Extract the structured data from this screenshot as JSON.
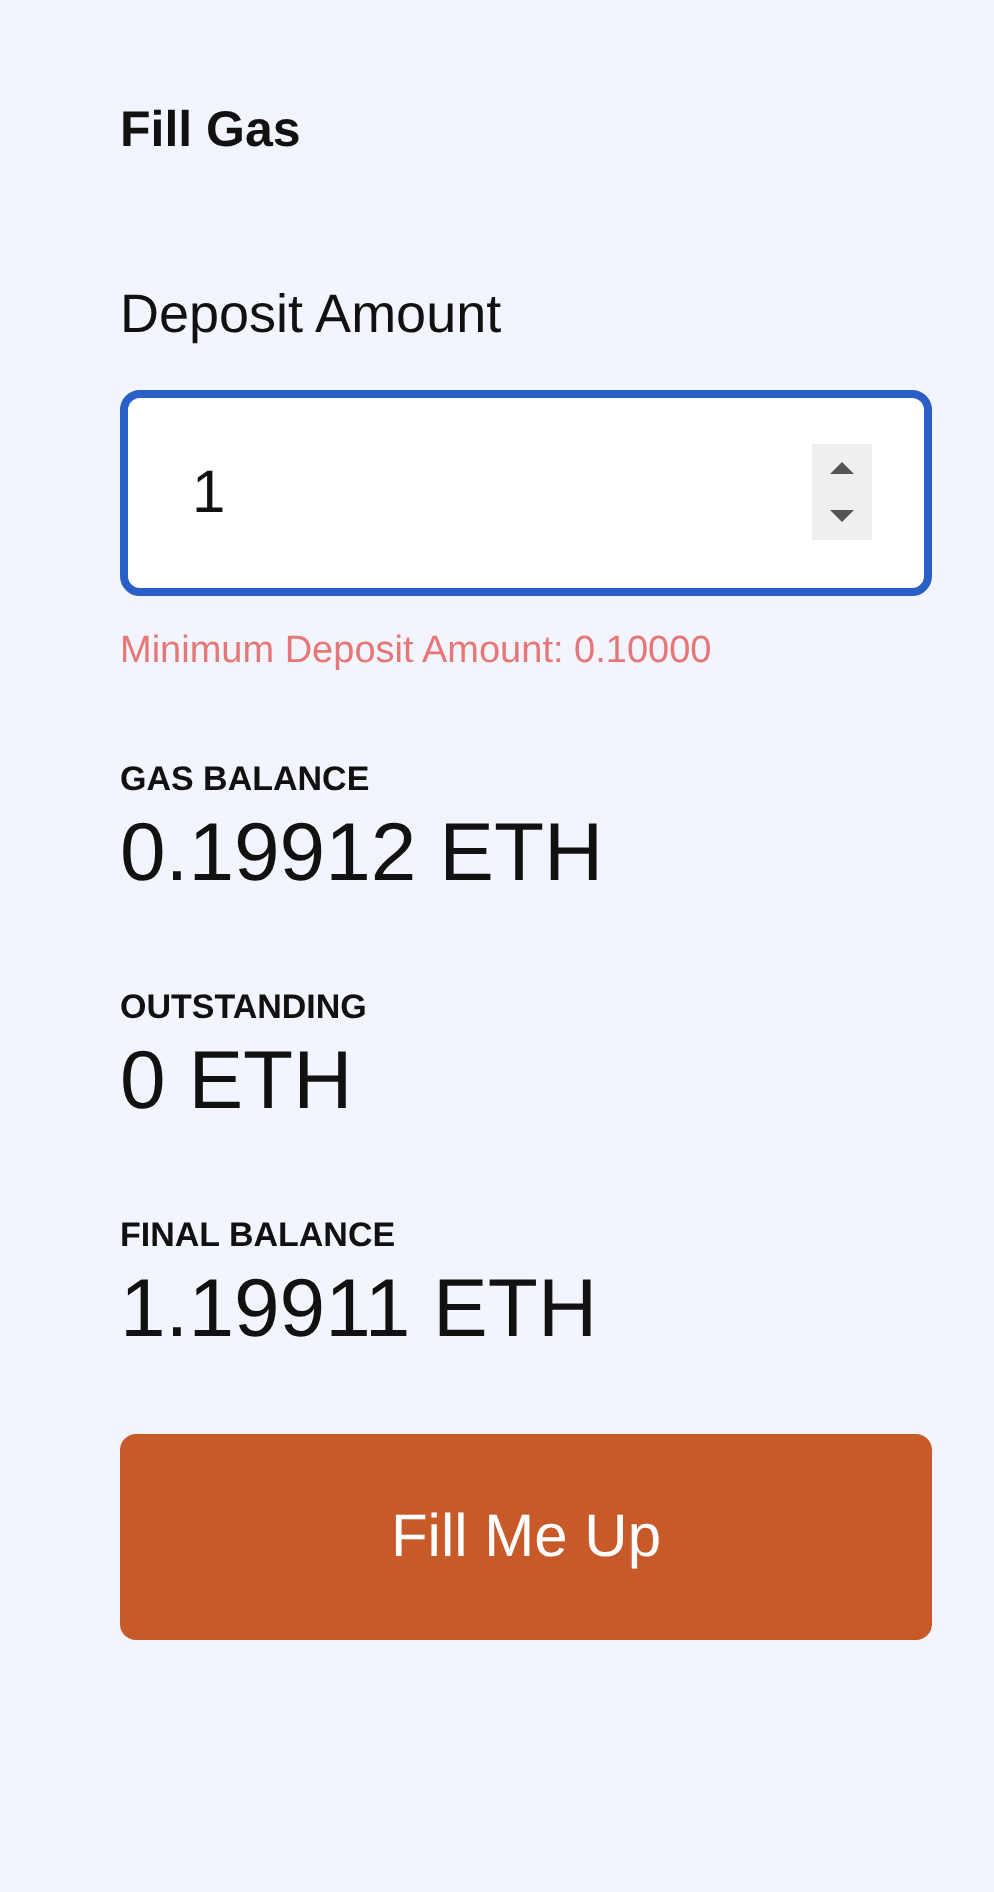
{
  "title": "Fill Gas",
  "deposit": {
    "label": "Deposit Amount",
    "value": "1",
    "focused": true,
    "hint": "Minimum Deposit Amount: 0.10000"
  },
  "stats": [
    {
      "label": "GAS BALANCE",
      "value": "0.19912 ETH"
    },
    {
      "label": "OUTSTANDING",
      "value": "0 ETH"
    },
    {
      "label": "FINAL BALANCE",
      "value": "1.19911 ETH"
    }
  ],
  "button": "Fill Me Up"
}
